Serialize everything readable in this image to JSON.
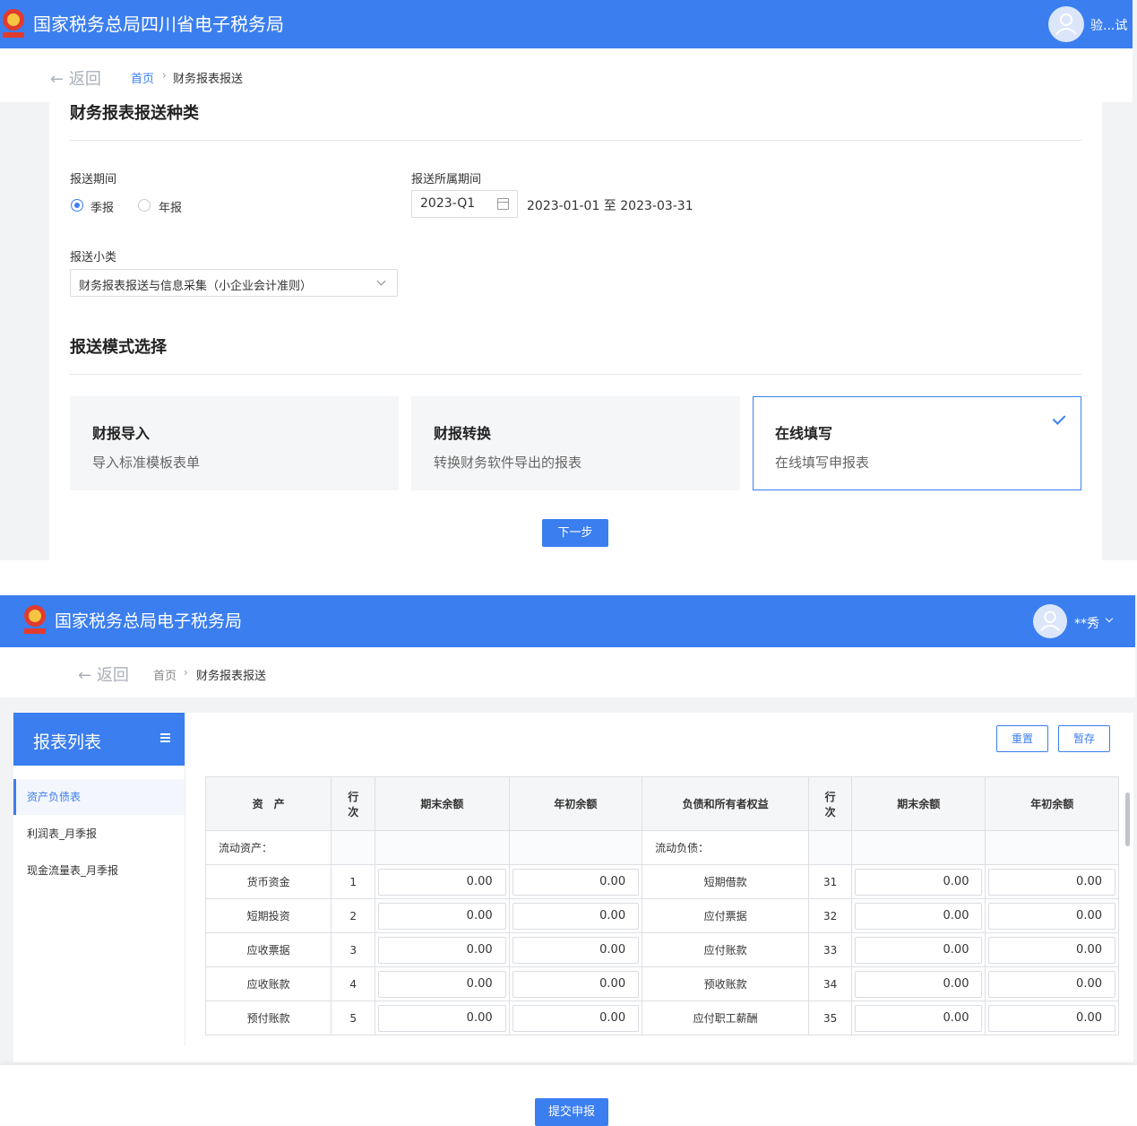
{
  "top": {
    "header": {
      "title": "国家税务总局四川省电子税务局",
      "user": "验...试"
    },
    "breadcrumb": {
      "back": "返回",
      "home": "首页",
      "current": "财务报表报送"
    },
    "section1": {
      "title": "财务报表报送种类",
      "period_label": "报送期间",
      "period_options": [
        {
          "label": "季报",
          "selected": true
        },
        {
          "label": "年报",
          "selected": false
        }
      ],
      "belong_period_label": "报送所属期间",
      "belong_period_value": "2023-Q1",
      "date_range": "2023-01-01 至 2023-03-31",
      "subtype_label": "报送小类",
      "subtype_value": "财务报表报送与信息采集（小企业会计准则）"
    },
    "section2": {
      "title": "报送模式选择",
      "modes": [
        {
          "title": "财报导入",
          "desc": "导入标准模板表单",
          "selected": false
        },
        {
          "title": "财报转换",
          "desc": "转换财务软件导出的报表",
          "selected": false
        },
        {
          "title": "在线填写",
          "desc": "在线填写申报表",
          "selected": true
        }
      ],
      "next_button": "下一步"
    }
  },
  "bottom": {
    "header": {
      "title": "国家税务总局电子税务局",
      "user": "**秀"
    },
    "breadcrumb": {
      "back": "返回",
      "home": "首页",
      "current": "财务报表报送"
    },
    "sidebar": {
      "title": "报表列表",
      "items": [
        {
          "label": "资产负债表",
          "active": true
        },
        {
          "label": "利润表_月季报",
          "active": false
        },
        {
          "label": "现金流量表_月季报",
          "active": false
        }
      ]
    },
    "toolbar": {
      "reset": "重置",
      "save": "暂存"
    },
    "table": {
      "headers": [
        "资　产",
        "行次",
        "期末余额",
        "年初余额",
        "负债和所有者权益",
        "行次",
        "期末余额",
        "年初余额"
      ],
      "category_row": {
        "left": "流动资产：",
        "right": "流动负债："
      },
      "rows": [
        {
          "asset": "货币资金",
          "a_no": "1",
          "a_end": "0.00",
          "a_begin": "0.00",
          "liab": "短期借款",
          "l_no": "31",
          "l_end": "0.00",
          "l_begin": "0.00"
        },
        {
          "asset": "短期投资",
          "a_no": "2",
          "a_end": "0.00",
          "a_begin": "0.00",
          "liab": "应付票据",
          "l_no": "32",
          "l_end": "0.00",
          "l_begin": "0.00"
        },
        {
          "asset": "应收票据",
          "a_no": "3",
          "a_end": "0.00",
          "a_begin": "0.00",
          "liab": "应付账款",
          "l_no": "33",
          "l_end": "0.00",
          "l_begin": "0.00"
        },
        {
          "asset": "应收账款",
          "a_no": "4",
          "a_end": "0.00",
          "a_begin": "0.00",
          "liab": "预收账款",
          "l_no": "34",
          "l_end": "0.00",
          "l_begin": "0.00"
        },
        {
          "asset": "预付账款",
          "a_no": "5",
          "a_end": "0.00",
          "a_begin": "0.00",
          "liab": "应付职工薪酬",
          "l_no": "35",
          "l_end": "0.00",
          "l_begin": "0.00"
        }
      ]
    },
    "submit_button": "提交申报"
  }
}
